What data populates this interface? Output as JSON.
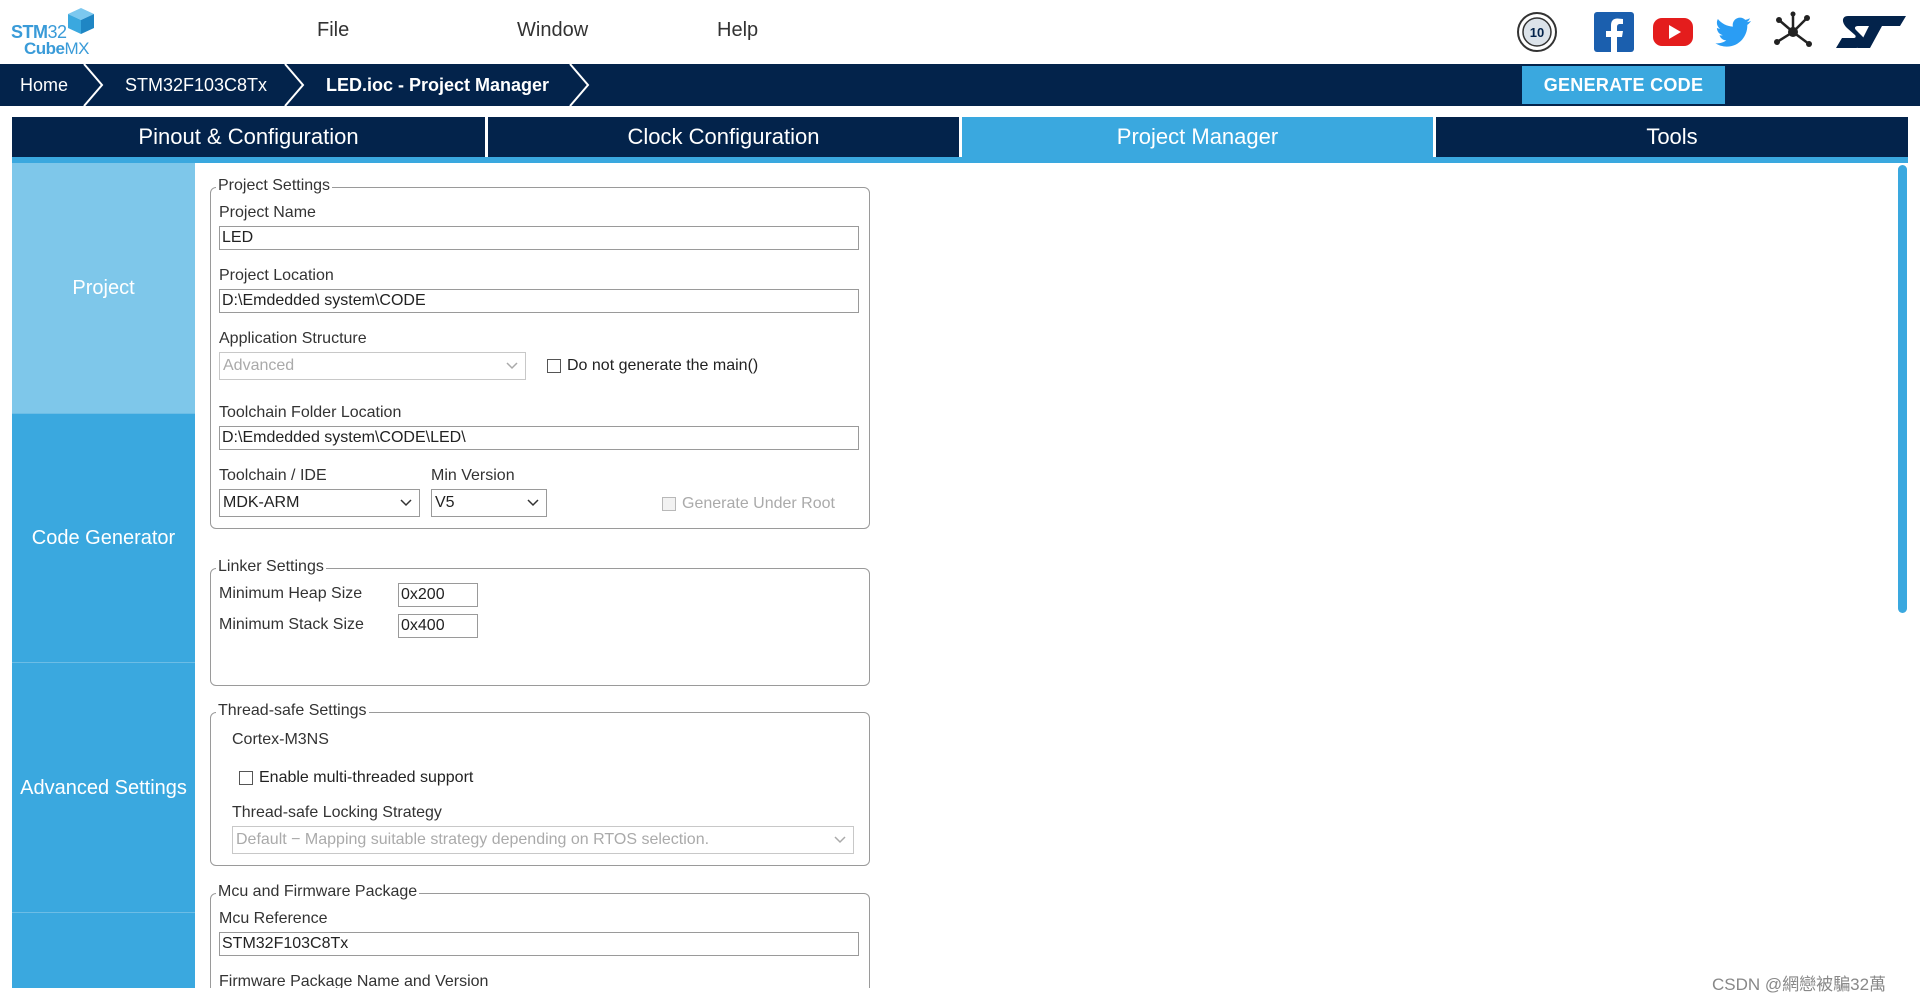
{
  "app": {
    "logo": {
      "line1_bold": "STM",
      "line1_thin": "32",
      "line2_bold": "Cube",
      "line2_thin": "MX"
    },
    "menu": {
      "file": "File",
      "window": "Window",
      "help": "Help"
    },
    "social_icons": [
      "10-years-badge-icon",
      "facebook-icon",
      "youtube-icon",
      "twitter-icon",
      "network-icon",
      "st-logo-icon"
    ]
  },
  "breadcrumb": {
    "items": [
      "Home",
      "STM32F103C8Tx",
      "LED.ioc - Project Manager"
    ],
    "generate_label": "GENERATE CODE"
  },
  "tabs": [
    {
      "label": "Pinout & Configuration",
      "active": false
    },
    {
      "label": "Clock Configuration",
      "active": false
    },
    {
      "label": "Project Manager",
      "active": true
    },
    {
      "label": "Tools",
      "active": false
    }
  ],
  "sidebar": {
    "items": [
      "Project",
      "Code Generator",
      "Advanced Settings"
    ],
    "active": "Project"
  },
  "project_settings": {
    "legend": "Project Settings",
    "name_label": "Project Name",
    "name_value": "LED",
    "location_label": "Project Location",
    "location_value": "D:\\Emdedded system\\CODE",
    "app_structure_label": "Application Structure",
    "app_structure_value": "Advanced",
    "no_main_label": "Do not generate the main()",
    "toolchain_folder_label": "Toolchain Folder Location",
    "toolchain_folder_value": "D:\\Emdedded system\\CODE\\LED\\",
    "toolchain_ide_label": "Toolchain / IDE",
    "toolchain_ide_value": "MDK-ARM",
    "min_version_label": "Min Version",
    "min_version_value": "V5",
    "generate_under_root_label": "Generate Under Root"
  },
  "linker_settings": {
    "legend": "Linker Settings",
    "heap_label": "Minimum Heap Size",
    "heap_value": "0x200",
    "stack_label": "Minimum Stack Size",
    "stack_value": "0x400"
  },
  "thread_safe": {
    "legend": "Thread-safe Settings",
    "core": "Cortex-M3NS",
    "multithread_label": "Enable multi-threaded support",
    "strategy_label": "Thread-safe Locking Strategy",
    "strategy_value": "Default  −  Mapping suitable strategy depending on RTOS selection."
  },
  "mcu_firmware": {
    "legend": "Mcu and Firmware Package",
    "mcu_ref_label": "Mcu Reference",
    "mcu_ref_value": "STM32F103C8Tx",
    "fw_label": "Firmware Package Name and Version"
  },
  "watermark": "CSDN @網戀被騙32萬",
  "colors": {
    "navy": "#03234b",
    "accent": "#3aa8df",
    "light_accent": "#7ec7ea"
  }
}
